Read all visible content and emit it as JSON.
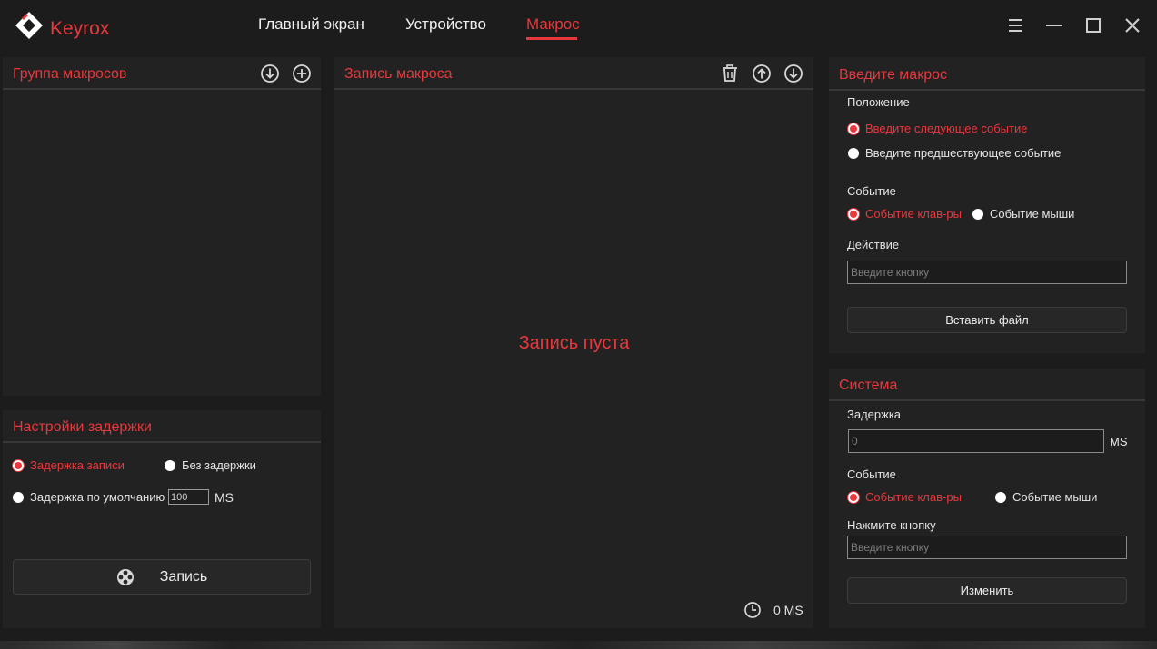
{
  "app": {
    "brand": "Keyrox",
    "accent_color": "#e8383d",
    "nav": [
      {
        "label": "Главный экран",
        "active": false
      },
      {
        "label": "Устройство",
        "active": false
      },
      {
        "label": "Макрос",
        "active": true
      }
    ],
    "window_controls": [
      "menu-icon",
      "minimize-icon",
      "maximize-icon",
      "close-icon"
    ]
  },
  "macro_group": {
    "title": "Группа макросов",
    "icons": [
      "download-circle-icon",
      "add-circle-icon"
    ]
  },
  "delay_settings": {
    "title": "Настройки задержки",
    "option_record_delay": "Задержка записи",
    "option_no_delay": "Без задержки",
    "option_default_delay": "Задержка по умолчанию",
    "default_delay_value": "100",
    "unit": "MS",
    "record_button": "Запись"
  },
  "macro_record": {
    "title": "Запись макроса",
    "icons": [
      "trash-icon",
      "move-up-icon",
      "move-down-icon"
    ],
    "empty_message": "Запись пуста",
    "total_time": "0 MS"
  },
  "enter_macro": {
    "title": "Введите макрос",
    "position_label": "Положение",
    "position_next": "Введите следующее событие",
    "position_prev": "Введите предшествующее событие",
    "event_label": "Событие",
    "event_keyboard": "Событие клав-ры",
    "event_mouse": "Событие мыши",
    "action_label": "Действие",
    "action_placeholder": "Введите кнопку",
    "insert_file_button": "Вставить файл"
  },
  "system": {
    "title": "Система",
    "delay_label": "Задержка",
    "delay_placeholder": "0",
    "unit": "MS",
    "event_label": "Событие",
    "event_keyboard": "Событие клав-ры",
    "event_mouse": "Событие мыши",
    "press_key_label": "Нажмите кнопку",
    "press_key_placeholder": "Введите кнопку",
    "change_button": "Изменить"
  }
}
